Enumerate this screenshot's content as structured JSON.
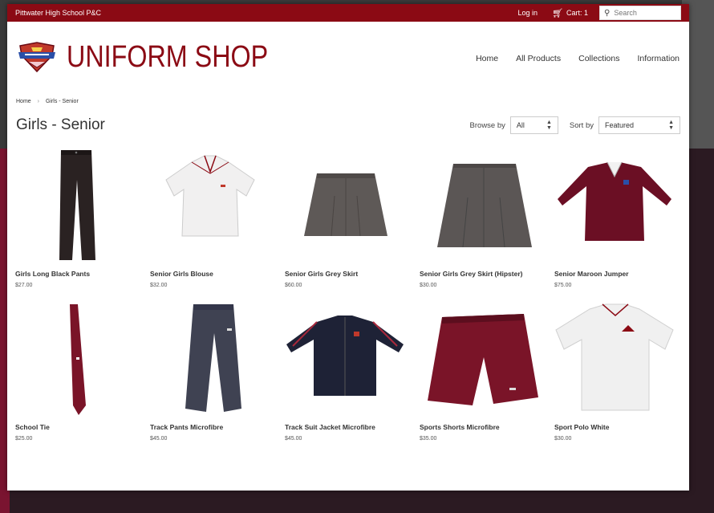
{
  "colors": {
    "brand": "#8b0a14",
    "text": "#333333"
  },
  "topbar": {
    "brand": "Pittwater High School P&C",
    "login": "Log in",
    "cart_label": "Cart: 1",
    "cart_icon": "cart-icon",
    "search_placeholder": "Search",
    "search_icon": "search-icon"
  },
  "header": {
    "logo_text": "UNIFORM SHOP",
    "nav": [
      "Home",
      "All Products",
      "Collections",
      "Information"
    ]
  },
  "breadcrumb": {
    "home": "Home",
    "sep": "›",
    "current": "Girls - Senior"
  },
  "collection": {
    "title": "Girls - Senior",
    "browse_label": "Browse by",
    "browse_value": "All",
    "sort_label": "Sort by",
    "sort_value": "Featured"
  },
  "products": [
    {
      "name": "Girls Long Black Pants",
      "price": "$27.00"
    },
    {
      "name": "Senior Girls Blouse",
      "price": "$32.00"
    },
    {
      "name": "Senior Girls Grey Skirt",
      "price": "$60.00"
    },
    {
      "name": "Senior Girls Grey Skirt (Hipster)",
      "price": "$30.00"
    },
    {
      "name": "Senior Maroon Jumper",
      "price": "$75.00"
    },
    {
      "name": "School Tie",
      "price": "$25.00"
    },
    {
      "name": "Track Pants Microfibre",
      "price": "$45.00"
    },
    {
      "name": "Track Suit Jacket Microfibre",
      "price": "$45.00"
    },
    {
      "name": "Sports Shorts Microfibre",
      "price": "$35.00"
    },
    {
      "name": "Sport Polo White",
      "price": "$30.00"
    }
  ]
}
